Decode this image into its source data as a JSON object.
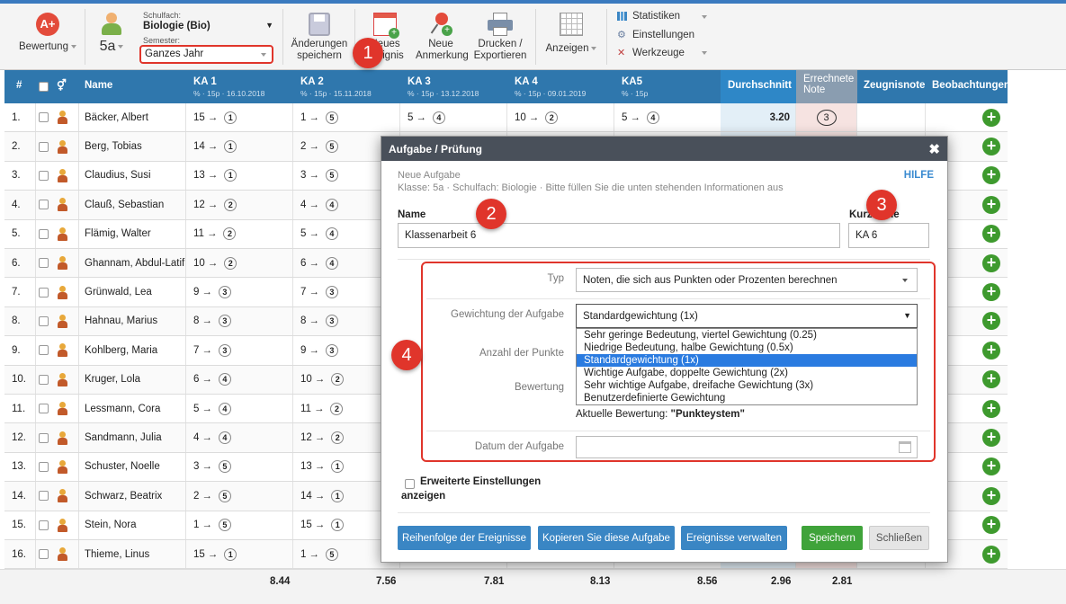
{
  "toolbar": {
    "rating_label": "Bewertung",
    "class_name": "5a",
    "subject_caption": "Schulfach:",
    "subject_value": "Biologie (Bio)",
    "semester_caption": "Semester:",
    "semester_value": "Ganzes Jahr",
    "save_label_1": "Änderungen",
    "save_label_2": "speichern",
    "new_event_label_1": "Neues",
    "new_event_label_2": "Ereignis",
    "new_note_label_1": "Neue",
    "new_note_label_2": "Anmerkung",
    "print_label_1": "Drucken /",
    "print_label_2": "Exportieren",
    "view_label": "Anzeigen",
    "stats_label": "Statistiken",
    "settings_label": "Einstellungen",
    "tools_label": "Werkzeuge"
  },
  "table": {
    "headers": {
      "num": "#",
      "name": "Name",
      "ka1": "KA 1",
      "ka1_sub": "% · 15p · 16.10.2018",
      "ka2": "KA 2",
      "ka2_sub": "% · 15p · 15.11.2018",
      "ka3": "KA 3",
      "ka3_sub": "% · 15p · 13.12.2018",
      "ka4": "KA 4",
      "ka4_sub": "% · 15p · 09.01.2019",
      "ka5": "KA5",
      "ka5_sub": "% · 15p",
      "avg": "Durchschnitt",
      "calc_1": "Errechnete",
      "calc_2": "Note",
      "report": "Zeugnisnote",
      "obs": "Beobachtungen"
    },
    "rows": [
      {
        "num": "1.",
        "name": "Bäcker, Albert",
        "ka1": [
          "15",
          "1"
        ],
        "ka2": [
          "1",
          "5"
        ],
        "ka3": [
          "5",
          "4"
        ],
        "ka4": [
          "10",
          "2"
        ],
        "ka5": [
          "5",
          "4"
        ],
        "avg": "3.20",
        "calc": "3"
      },
      {
        "num": "2.",
        "name": "Berg, Tobias",
        "ka1": [
          "14",
          "1"
        ],
        "ka2": [
          "2",
          "5"
        ]
      },
      {
        "num": "3.",
        "name": "Claudius, Susi",
        "ka1": [
          "13",
          "1"
        ],
        "ka2": [
          "3",
          "5"
        ]
      },
      {
        "num": "4.",
        "name": "Clauß, Sebastian",
        "ka1": [
          "12",
          "2"
        ],
        "ka2": [
          "4",
          "4"
        ]
      },
      {
        "num": "5.",
        "name": "Flämig, Walter",
        "ka1": [
          "11",
          "2"
        ],
        "ka2": [
          "5",
          "4"
        ]
      },
      {
        "num": "6.",
        "name": "Ghannam, Abdul-Latif",
        "ka1": [
          "10",
          "2"
        ],
        "ka2": [
          "6",
          "4"
        ]
      },
      {
        "num": "7.",
        "name": "Grünwald, Lea",
        "ka1": [
          "9",
          "3"
        ],
        "ka2": [
          "7",
          "3"
        ]
      },
      {
        "num": "8.",
        "name": "Hahnau, Marius",
        "ka1": [
          "8",
          "3"
        ],
        "ka2": [
          "8",
          "3"
        ]
      },
      {
        "num": "9.",
        "name": "Kohlberg, Maria",
        "ka1": [
          "7",
          "3"
        ],
        "ka2": [
          "9",
          "3"
        ]
      },
      {
        "num": "10.",
        "name": "Kruger, Lola",
        "ka1": [
          "6",
          "4"
        ],
        "ka2": [
          "10",
          "2"
        ]
      },
      {
        "num": "11.",
        "name": "Lessmann, Cora",
        "ka1": [
          "5",
          "4"
        ],
        "ka2": [
          "11",
          "2"
        ]
      },
      {
        "num": "12.",
        "name": "Sandmann, Julia",
        "ka1": [
          "4",
          "4"
        ],
        "ka2": [
          "12",
          "2"
        ]
      },
      {
        "num": "13.",
        "name": "Schuster, Noelle",
        "ka1": [
          "3",
          "5"
        ],
        "ka2": [
          "13",
          "1"
        ]
      },
      {
        "num": "14.",
        "name": "Schwarz, Beatrix",
        "ka1": [
          "2",
          "5"
        ],
        "ka2": [
          "14",
          "1"
        ]
      },
      {
        "num": "15.",
        "name": "Stein, Nora",
        "ka1": [
          "1",
          "5"
        ],
        "ka2": [
          "15",
          "1"
        ]
      },
      {
        "num": "16.",
        "name": "Thieme, Linus",
        "ka1": [
          "15",
          "1"
        ],
        "ka2": [
          "1",
          "5"
        ]
      }
    ],
    "footer": {
      "ka1": "8.44",
      "ka2": "7.56",
      "ka3": "7.81",
      "ka4": "8.13",
      "ka5": "8.56",
      "avg": "2.96",
      "calc": "2.81"
    }
  },
  "modal": {
    "title": "Aufgabe / Prüfung",
    "help": "HILFE",
    "subtitle": "Neue Aufgabe",
    "info": "Klasse: 5a · Schulfach: Biologie · Bitte füllen Sie die unten stehenden Informationen aus",
    "name_label": "Name",
    "name_value": "Klassenarbeit 6",
    "short_label": "Kurzname",
    "short_value": "KA 6",
    "type_label": "Typ",
    "type_value": "Noten, die sich aus Punkten oder Prozenten berechnen",
    "weight_label": "Gewichtung der Aufgabe",
    "weight_value": "Standardgewichtung (1x)",
    "weight_options": [
      "Sehr geringe Bedeutung, viertel Gewichtung (0.25)",
      "Niedrige Bedeutung, halbe Gewichtung (0.5x)",
      "Standardgewichtung (1x)",
      "Wichtige Aufgabe, doppelte Gewichtung (2x)",
      "Sehr wichtige Aufgabe, dreifache Gewichtung (3x)",
      "Benutzerdefinierte Gewichtung"
    ],
    "points_label": "Anzahl der Punkte",
    "rating_label": "Bewertung",
    "current_rating_prefix": "Aktuelle Bewertung:",
    "current_rating_value": "\"Punkteystem\"",
    "date_label": "Datum der Aufgabe",
    "advanced_1": "Erweiterte Einstellungen",
    "advanced_2": "anzeigen",
    "buttons": {
      "order": "Reihenfolge der Ereignisse",
      "copy": "Kopieren Sie diese Aufgabe",
      "manage": "Ereignisse verwalten",
      "save": "Speichern",
      "close": "Schließen"
    }
  },
  "badges": [
    "1",
    "2",
    "3",
    "4"
  ],
  "colors": {
    "header_blue": "#2f77ad",
    "accent_red": "#e0352b",
    "save_green": "#3fa33a",
    "btn_blue": "#3a86c4"
  }
}
